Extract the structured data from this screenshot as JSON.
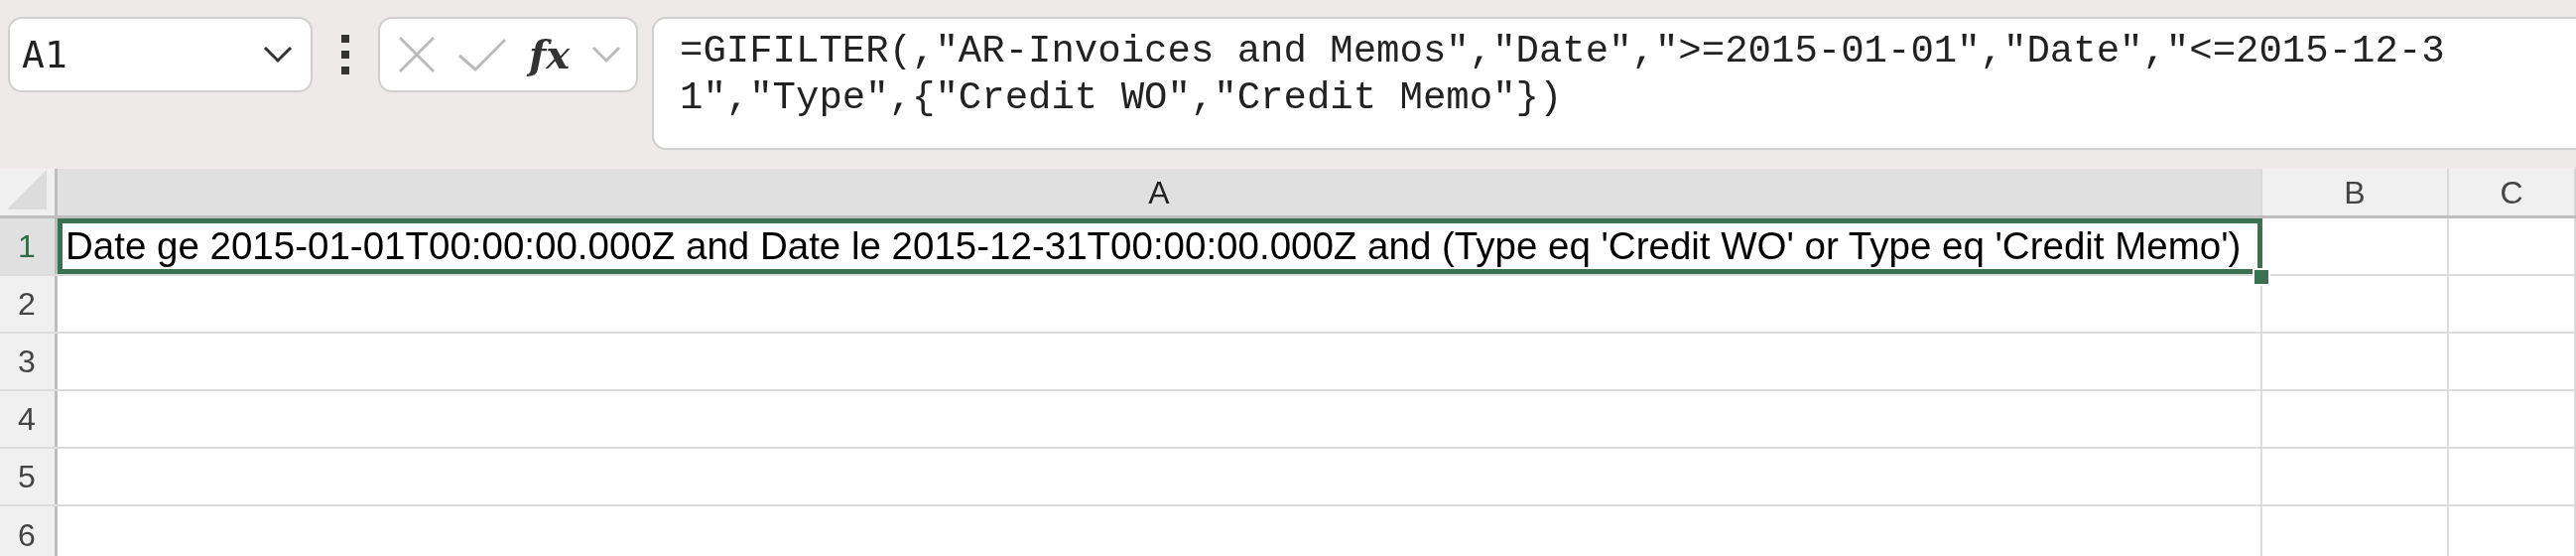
{
  "name_box": {
    "value": "A1"
  },
  "formula_bar": {
    "function_label": "fx",
    "formula": "=GIFILTER(,\"AR-Invoices and Memos\",\"Date\",\">=2015-01-01\",\"Date\",\"<=2015-12-31\",\"Type\",{\"Credit WO\",\"Credit Memo\"})"
  },
  "columns": [
    {
      "label": "A",
      "selected": true
    },
    {
      "label": "B",
      "selected": false
    },
    {
      "label": "C",
      "selected": false
    }
  ],
  "rows": [
    {
      "label": "1",
      "selected": true,
      "cells": [
        {
          "text": "Date ge 2015-01-01T00:00:00.000Z and Date le 2015-12-31T00:00:00.000Z and (Type eq 'Credit WO' or Type eq 'Credit Memo')",
          "selected": true
        }
      ]
    },
    {
      "label": "2",
      "selected": false
    },
    {
      "label": "3",
      "selected": false
    },
    {
      "label": "4",
      "selected": false
    },
    {
      "label": "5",
      "selected": false
    },
    {
      "label": "6",
      "selected": false
    }
  ]
}
